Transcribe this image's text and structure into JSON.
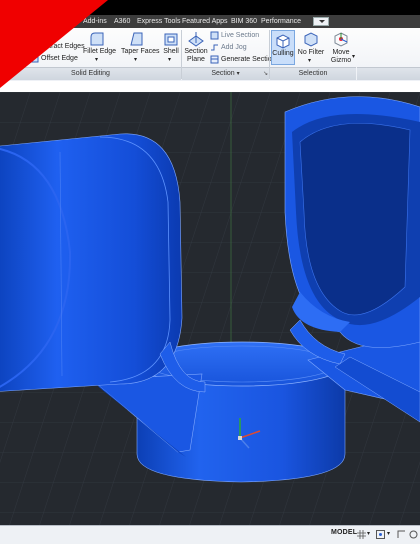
{
  "ribbon_tabs": [
    "Add-ins",
    "A360",
    "Express Tools",
    "Featured Apps",
    "BIM 360",
    "Performance"
  ],
  "solid_editing": {
    "panel_label": "Solid Editing",
    "extract_edges": "Extract Edges",
    "offset_edge": "Offset Edge",
    "fillet_edge": "Fillet Edge",
    "taper_faces": "Taper Faces",
    "shell": "Shell"
  },
  "section": {
    "panel_label": "Section",
    "section_plane_line1": "Section",
    "section_plane_line2": "Plane",
    "live_section": "Live Section",
    "add_jog": "Add Jog",
    "generate_section": "Generate Section"
  },
  "selection": {
    "panel_label": "Selection",
    "culling": "Culling",
    "no_filter": "No Filter",
    "move_gizmo_line1": "Move",
    "move_gizmo_line2": "Gizmo"
  },
  "status": {
    "model": "MODEL"
  },
  "colors": {
    "accent": "#1f57d4",
    "viewport_bg": "#25292f",
    "red_corner": "#f00000"
  }
}
